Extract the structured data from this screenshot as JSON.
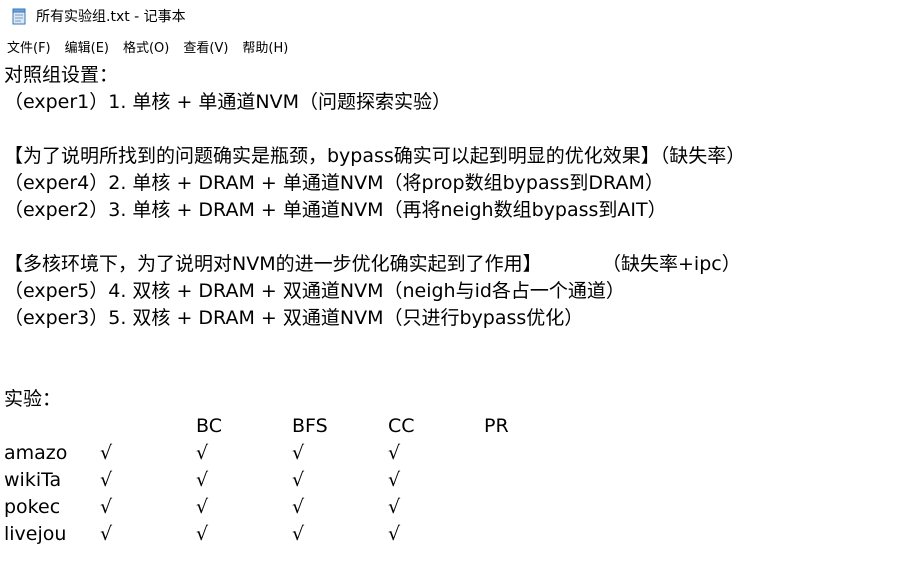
{
  "window": {
    "title": "所有实验组.txt - 记事本",
    "icon": "notepad-icon"
  },
  "menu": [
    {
      "label": "文件(F)"
    },
    {
      "label": "编辑(E)"
    },
    {
      "label": "格式(O)"
    },
    {
      "label": "查看(V)"
    },
    {
      "label": "帮助(H)"
    }
  ],
  "document": {
    "lines": [
      "对照组设置：",
      "（exper1）1. 单核 + 单通道NVM（问题探索实验）",
      "",
      "【为了说明所找到的问题确实是瓶颈，bypass确实可以起到明显的优化效果】（缺失率）",
      "（exper4）2. 单核 + DRAM + 单通道NVM（将prop数组bypass到DRAM）",
      "（exper2）3. 单核 + DRAM + 单通道NVM（再将neigh数组bypass到AIT）",
      "",
      "【多核环境下，为了说明对NVM的进一步优化确实起到了作用】          （缺失率+ipc）",
      "（exper5）4. 双核 + DRAM + 双通道NVM（neigh与id各占一个通道）",
      "（exper3）5. 双核 + DRAM + 双通道NVM（只进行bypass优化）",
      "",
      "",
      "",
      "实验："
    ],
    "table": {
      "headers": [
        "BC",
        "BFS",
        "CC",
        "PR"
      ],
      "rows": [
        {
          "name": "amazo",
          "marks": [
            "√",
            "√",
            "√",
            "√"
          ]
        },
        {
          "name": "wikiTa",
          "marks": [
            "√",
            "√",
            "√",
            "√"
          ]
        },
        {
          "name": "pokec",
          "marks": [
            "√",
            "√",
            "√",
            "√"
          ]
        },
        {
          "name": "livejou",
          "marks": [
            "√",
            "√",
            "√",
            "√"
          ]
        }
      ]
    }
  }
}
